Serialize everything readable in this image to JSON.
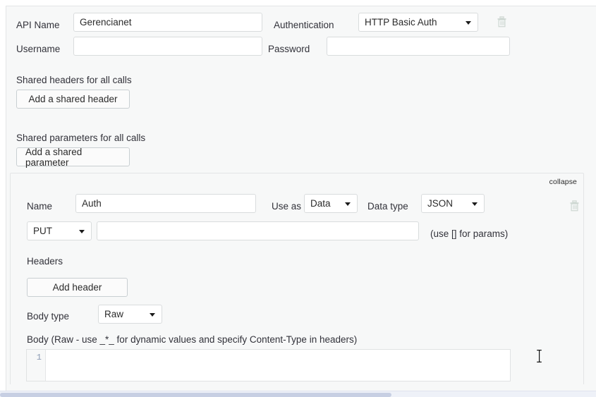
{
  "api": {
    "name_label": "API Name",
    "name_value": "Gerencianet",
    "auth_label": "Authentication",
    "auth_value": "HTTP Basic Auth",
    "username_label": "Username",
    "username_value": "",
    "password_label": "Password",
    "password_value": "",
    "delete_icon": "trash-icon"
  },
  "shared": {
    "headers_label": "Shared headers for all calls",
    "add_header_button": "Add a shared header",
    "parameters_label": "Shared parameters for all calls",
    "add_parameter_button": "Add a shared parameter"
  },
  "endpoint": {
    "collapse_link": "collapse",
    "name_label": "Name",
    "name_value": "Auth",
    "use_as_label": "Use as",
    "use_as_value": "Data",
    "data_type_label": "Data type",
    "data_type_value": "JSON",
    "method_value": "PUT",
    "url_value": "",
    "url_hint": "(use [] for params)",
    "headers_label": "Headers",
    "add_header_button": "Add header",
    "body_type_label": "Body type",
    "body_type_value": "Raw",
    "body_label": "Body (Raw - use _*_ for dynamic values and specify Content-Type in headers)",
    "body_value": "",
    "body_line_number": "1",
    "delete_icon": "trash-icon"
  },
  "colors": {
    "page_bg": "#f7f8f8",
    "border": "#e3e5e6",
    "input_border": "#d9dcdd",
    "button_border": "#c9cfd2",
    "text": "#2b2b2b",
    "trash": "#cfd8d3",
    "scrollbar_thumb": "#c7cfe3",
    "gutter_number": "#8b9ab3"
  }
}
